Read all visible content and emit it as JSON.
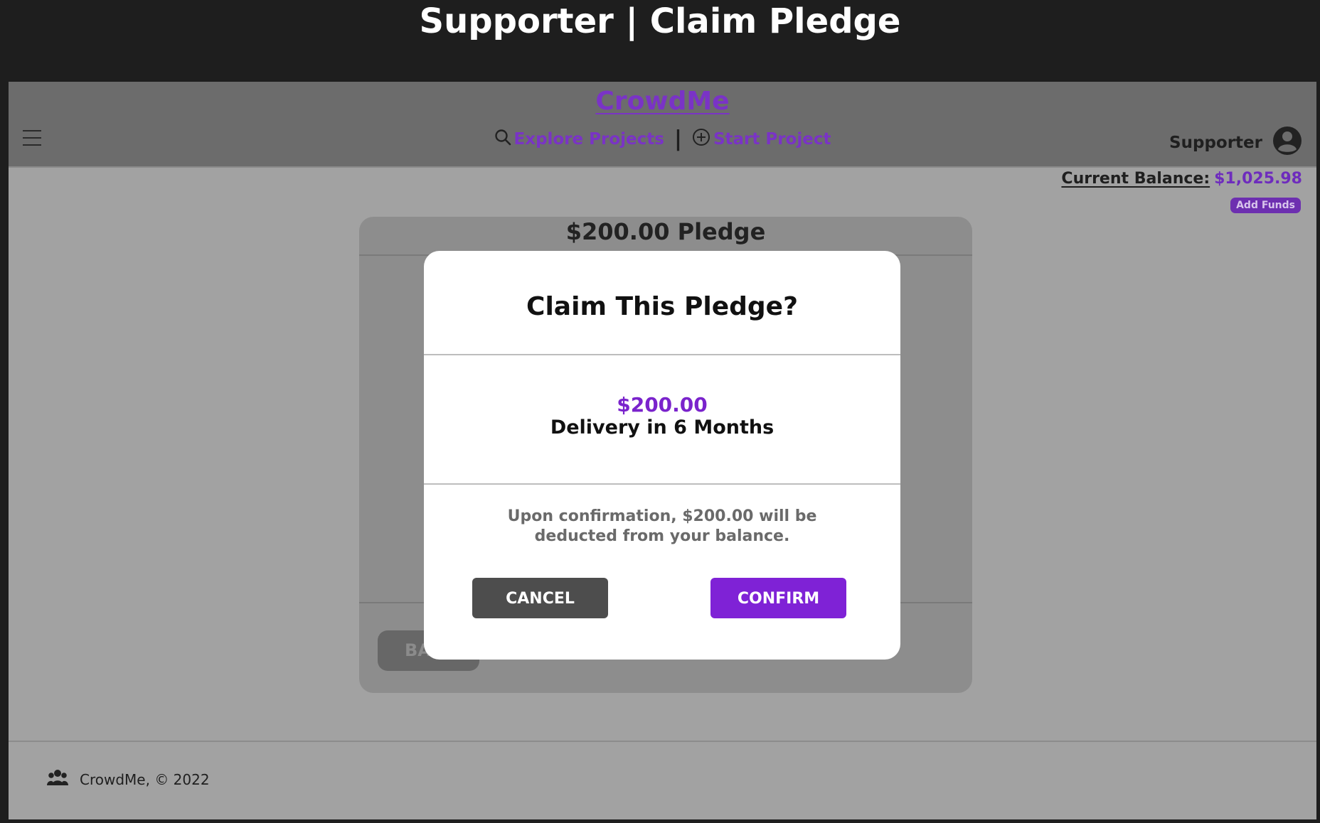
{
  "window": {
    "title": "Supporter | Claim Pledge"
  },
  "navbar": {
    "brand": "CrowdMe",
    "links": [
      {
        "label": "Explore Projects",
        "icon": "search-icon"
      },
      {
        "label": "Start Project",
        "icon": "plus-circle-icon"
      }
    ],
    "separator": "|",
    "user_role": "Supporter",
    "user_icon": "user-avatar-icon"
  },
  "balance": {
    "label": "Current Balance:",
    "value": "$1,025.98",
    "add_funds": "Add Funds"
  },
  "card": {
    "title": "$200.00 Pledge",
    "back_label": "BA"
  },
  "modal": {
    "title": "Claim This Pledge?",
    "amount": "$200.00",
    "delivery": "Delivery in 6 Months",
    "note": "Upon confirmation, $200.00 will be deducted from your balance.",
    "cancel_label": "CANCEL",
    "confirm_label": "CONFIRM"
  },
  "footer": {
    "text": "CrowdMe, © 2022",
    "icon": "users-icon"
  },
  "colors": {
    "accent": "#7f22d6",
    "background": "#1e1e1e"
  }
}
